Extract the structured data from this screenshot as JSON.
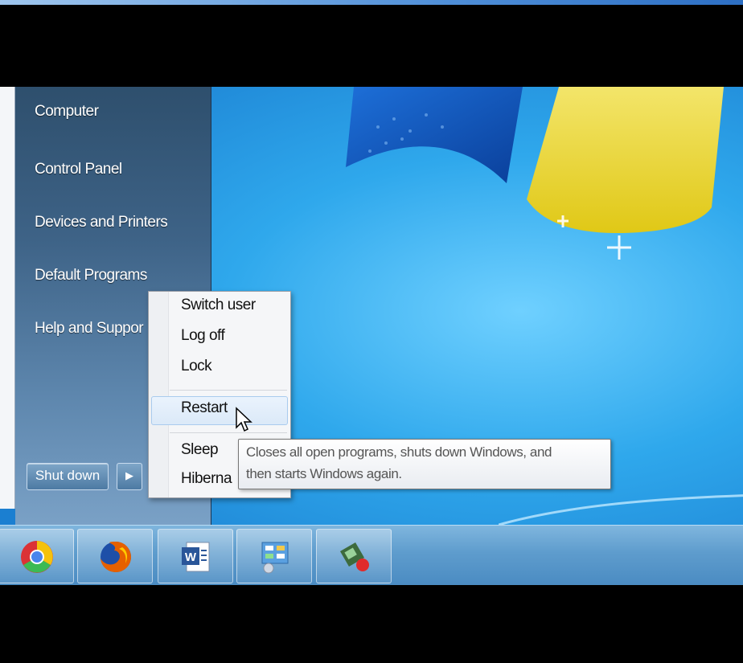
{
  "start_menu": {
    "items": [
      {
        "label": "Computer"
      },
      {
        "label": "Control Panel"
      },
      {
        "label": "Devices and Printers"
      },
      {
        "label": "Default Programs"
      },
      {
        "label": "Help and Suppor"
      }
    ],
    "shutdown_label": "Shut down",
    "shutdown_arrow": "▶"
  },
  "shutdown_menu": {
    "items": [
      {
        "label": "Switch user"
      },
      {
        "label": "Log off"
      },
      {
        "label": "Lock"
      },
      {
        "label": "Restart"
      },
      {
        "label": "Sleep"
      },
      {
        "label": "Hiberna"
      }
    ],
    "highlighted": "Restart"
  },
  "tooltip": {
    "line1": "Closes all open programs, shuts down Windows, and",
    "line2": "then starts Windows again."
  },
  "taskbar": {
    "apps": [
      "chrome-icon",
      "firefox-icon",
      "word-icon",
      "control-panel-icon",
      "app-icon"
    ]
  },
  "colors": {
    "desktop": "#2fa8ec",
    "start_menu": "#3e6387",
    "taskbar": "#5e9ccd",
    "accent_yellow": "#f4e44a"
  }
}
